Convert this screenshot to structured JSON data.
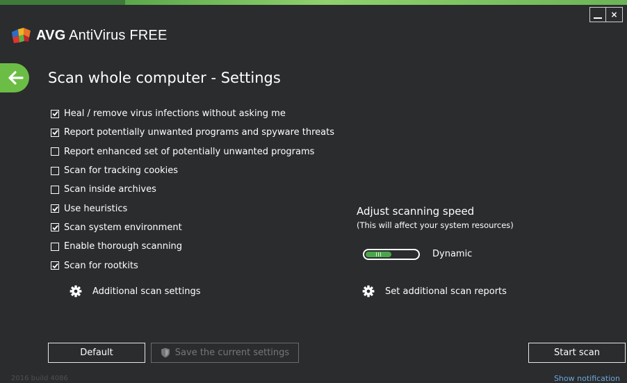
{
  "window": {
    "controls": {
      "minimize": "minimize",
      "close": "×"
    }
  },
  "app": {
    "brand": "AVG",
    "product": "AntiVirus",
    "edition": "FREE"
  },
  "page": {
    "title": "Scan whole computer - Settings"
  },
  "options": [
    {
      "label": "Heal / remove virus infections without asking me",
      "checked": true
    },
    {
      "label": "Report potentially unwanted programs and spyware threats",
      "checked": true
    },
    {
      "label": "Report enhanced set of potentially unwanted programs",
      "checked": false
    },
    {
      "label": "Scan for tracking cookies",
      "checked": false
    },
    {
      "label": "Scan inside archives",
      "checked": false
    },
    {
      "label": "Use heuristics",
      "checked": true
    },
    {
      "label": "Scan system environment",
      "checked": true
    },
    {
      "label": "Enable thorough scanning",
      "checked": false
    },
    {
      "label": "Scan for rootkits",
      "checked": true
    }
  ],
  "links": {
    "additional_settings": "Additional scan settings",
    "additional_reports": "Set additional scan reports"
  },
  "speed": {
    "title": "Adjust scanning speed",
    "subtitle": "(This will affect your system resources)",
    "value": "Dynamic",
    "level": 0.5
  },
  "buttons": {
    "default": "Default",
    "save": "Save the current settings",
    "start": "Start scan"
  },
  "footer": {
    "version": "2016  build 4086",
    "notification": "Show notification"
  },
  "colors": {
    "background": "#2a2c2e",
    "accent_green": "#6cbd45",
    "slider_green": "#49a64a",
    "link_blue": "#6ea6d8"
  },
  "icons": [
    "back-arrow-icon",
    "gear-icon",
    "shield-icon",
    "checkbox-check-icon"
  ]
}
